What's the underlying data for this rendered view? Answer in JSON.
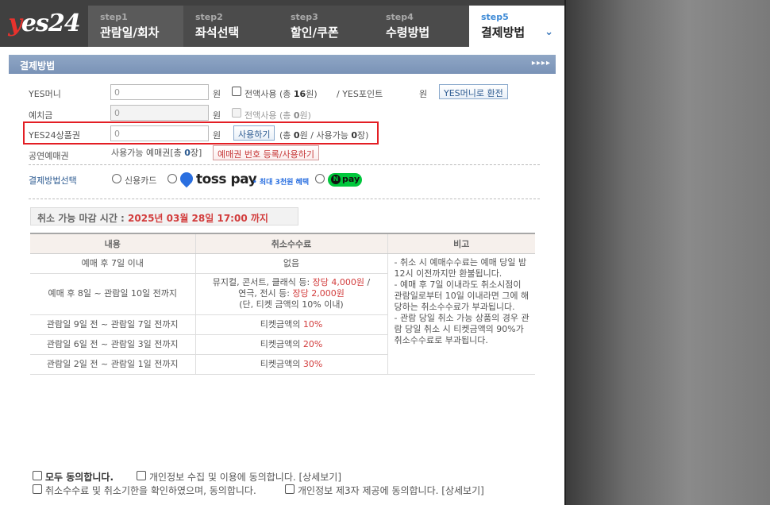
{
  "header": {
    "logo": "yes24",
    "steps": [
      {
        "num": "step1",
        "label": "관람일/회차"
      },
      {
        "num": "step2",
        "label": "좌석선택"
      },
      {
        "num": "step3",
        "label": "할인/쿠폰"
      },
      {
        "num": "step4",
        "label": "수령방법"
      },
      {
        "num": "step5",
        "label": "결제방법"
      }
    ]
  },
  "section": {
    "title": "결제방법",
    "arrows": "▸▸▸▸"
  },
  "payment": {
    "yes_money": {
      "label": "YES머니",
      "value": "0",
      "unit": "원",
      "use_all": "전액사용 (총 ",
      "use_all_amount": "16",
      "use_all_suffix": "원)",
      "points_label": "/ YES포인트",
      "points_unit": "원",
      "convert_btn": "YES머니로 환전"
    },
    "deposit": {
      "label": "예치금",
      "value": "0",
      "unit": "원",
      "use_all": "전액사용 (총 ",
      "use_all_amount": "0",
      "use_all_suffix": "원)"
    },
    "gift_card": {
      "label": "YES24상품권",
      "value": "0",
      "unit": "원",
      "use_btn": "사용하기",
      "summary_prefix": "(총 ",
      "total": "0",
      "summary_mid": "원 / 사용가능 ",
      "usable": "0",
      "summary_suffix": "장)"
    },
    "voucher": {
      "label": "공연예매권",
      "available_prefix": "사용가능 예매권[총 ",
      "available": "0",
      "available_suffix": "장]",
      "register_btn": "예매권 번호 등록/사용하기"
    },
    "method": {
      "label": "결제방법선택",
      "credit": "신용카드",
      "toss": "toss pay",
      "toss_note": "• 최대 3천원 혜택",
      "npay": "pay",
      "npay_n": "N"
    }
  },
  "cancel": {
    "deadline_label": "취소 가능 마감 시간 : ",
    "deadline_date": "2025년 03월 28일 17:00 까지",
    "headers": [
      "내용",
      "취소수수료",
      "비고"
    ],
    "rows": [
      {
        "period": "예매 후 7일 이내",
        "fee": "없음"
      },
      {
        "period": "예매 후 8일 ~ 관람일 10일 전까지",
        "fee_line1": "뮤지컬, 콘서트, 클래식 등: ",
        "fee_line1_red": "장당 4,000원",
        "fee_line1_end": " /",
        "fee_line2": "연극, 전시 등: ",
        "fee_line2_red": "장당 2,000원",
        "fee_line3": "(단, 티켓 금액의 10% 이내)"
      },
      {
        "period": "관람일 9일 전 ~ 관람일 7일 전까지",
        "fee": "티켓금액의 ",
        "pct": "10%"
      },
      {
        "period": "관람일 6일 전 ~ 관람일 3일 전까지",
        "fee": "티켓금액의 ",
        "pct": "20%"
      },
      {
        "period": "관람일 2일 전 ~ 관람일 1일 전까지",
        "fee": "티켓금액의 ",
        "pct": "30%"
      }
    ],
    "notes": [
      "- 취소 시 예매수수료는 예매 당일 밤 12시 이전까지만 환불됩니다.",
      "- 예매 후 7일 이내라도 취소시점이 관람일로부터 10일 이내라면 그에 해당하는 취소수수료가 부과됩니다.",
      "- 관람 당일 취소 가능 상품의 경우 관람 당일 취소 시 티켓금액의 90%가 취소수수료로 부과됩니다."
    ]
  },
  "agreements": {
    "all": "모두 동의합니다.",
    "privacy": "개인정보 수집 및 이용에 동의합니다. [상세보기]",
    "cancel_fee": "취소수수료 및 취소기한을 확인하였으며, 동의합니다.",
    "third_party": "개인정보 제3자 제공에 동의합니다. [상세보기]"
  }
}
